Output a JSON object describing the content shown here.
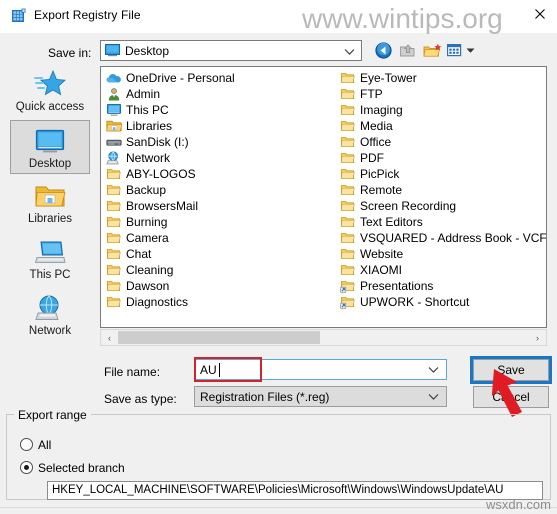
{
  "window": {
    "title": "Export Registry File",
    "title_icon": "registry-editor-icon",
    "close_label": "×"
  },
  "watermarks": {
    "top": "www.wintips.org",
    "bottom": "wsxdn.com"
  },
  "toolbar": {
    "save_in_label": "Save in:",
    "save_in_value": "Desktop",
    "buttons": [
      {
        "name": "back-button",
        "icon": "back-arrow-icon",
        "title": "Back"
      },
      {
        "name": "up-one-level-button",
        "icon": "up-folder-icon",
        "title": "Up One Level"
      },
      {
        "name": "new-folder-button",
        "icon": "new-folder-icon",
        "title": "Create New Folder"
      },
      {
        "name": "views-button",
        "icon": "views-grid-icon",
        "title": "Views"
      }
    ]
  },
  "places": [
    {
      "label": "Quick access",
      "icon": "star-icon",
      "selected": false
    },
    {
      "label": "Desktop",
      "icon": "monitor-icon",
      "selected": true
    },
    {
      "label": "Libraries",
      "icon": "libraries-folder-icon",
      "selected": false
    },
    {
      "label": "This PC",
      "icon": "computer-icon",
      "selected": false
    },
    {
      "label": "Network",
      "icon": "globe-network-icon",
      "selected": false
    }
  ],
  "file_list": {
    "left_column": [
      {
        "label": "OneDrive - Personal",
        "icon": "onedrive-cloud-icon"
      },
      {
        "label": "Admin",
        "icon": "user-icon"
      },
      {
        "label": "This PC",
        "icon": "computer-icon"
      },
      {
        "label": "Libraries",
        "icon": "libraries-folder-icon"
      },
      {
        "label": "SanDisk (I:)",
        "icon": "drive-icon"
      },
      {
        "label": "Network",
        "icon": "globe-network-icon"
      },
      {
        "label": "ABY-LOGOS",
        "icon": "folder-icon"
      },
      {
        "label": "Backup",
        "icon": "folder-icon"
      },
      {
        "label": "BrowsersMail",
        "icon": "folder-icon"
      },
      {
        "label": "Burning",
        "icon": "folder-icon"
      },
      {
        "label": "Camera",
        "icon": "folder-icon"
      },
      {
        "label": "Chat",
        "icon": "folder-icon"
      },
      {
        "label": "Cleaning",
        "icon": "folder-icon"
      },
      {
        "label": "Dawson",
        "icon": "folder-icon"
      },
      {
        "label": "Diagnostics",
        "icon": "folder-icon"
      }
    ],
    "right_column": [
      {
        "label": "Eye-Tower",
        "icon": "folder-icon"
      },
      {
        "label": "FTP",
        "icon": "folder-icon"
      },
      {
        "label": "Imaging",
        "icon": "folder-icon"
      },
      {
        "label": "Media",
        "icon": "folder-icon"
      },
      {
        "label": "Office",
        "icon": "folder-icon"
      },
      {
        "label": "PDF",
        "icon": "folder-icon"
      },
      {
        "label": "PicPick",
        "icon": "folder-icon"
      },
      {
        "label": "Remote",
        "icon": "folder-icon"
      },
      {
        "label": "Screen Recording",
        "icon": "folder-icon"
      },
      {
        "label": "Text Editors",
        "icon": "folder-icon"
      },
      {
        "label": "VSQUARED - Address Book - VCF",
        "icon": "folder-icon"
      },
      {
        "label": "Website",
        "icon": "folder-icon"
      },
      {
        "label": "XIAOMI",
        "icon": "folder-icon"
      },
      {
        "label": "Presentations",
        "icon": "folder-shortcut-icon"
      },
      {
        "label": "UPWORK - Shortcut",
        "icon": "folder-shortcut-icon"
      }
    ]
  },
  "scrollbar": {
    "left_arrow": "‹",
    "right_arrow": "›"
  },
  "form": {
    "file_name_label": "File name:",
    "file_name_value": "AU",
    "save_as_type_label": "Save as type:",
    "save_as_type_value": "Registration Files (*.reg)",
    "save_button": "Save",
    "cancel_button": "Cancel"
  },
  "export_range": {
    "group_title": "Export range",
    "option_all": "All",
    "option_selected_branch": "Selected branch",
    "selected": "Selected branch",
    "branch_path": "HKEY_LOCAL_MACHINE\\SOFTWARE\\Policies\\Microsoft\\Windows\\WindowsUpdate\\AU"
  },
  "annotations": {
    "red_box_target": "file-name-input",
    "blue_box_target": "save-button",
    "arrow_target": "save-button",
    "red_color": "#d62229",
    "blue_color": "#1878c8"
  }
}
